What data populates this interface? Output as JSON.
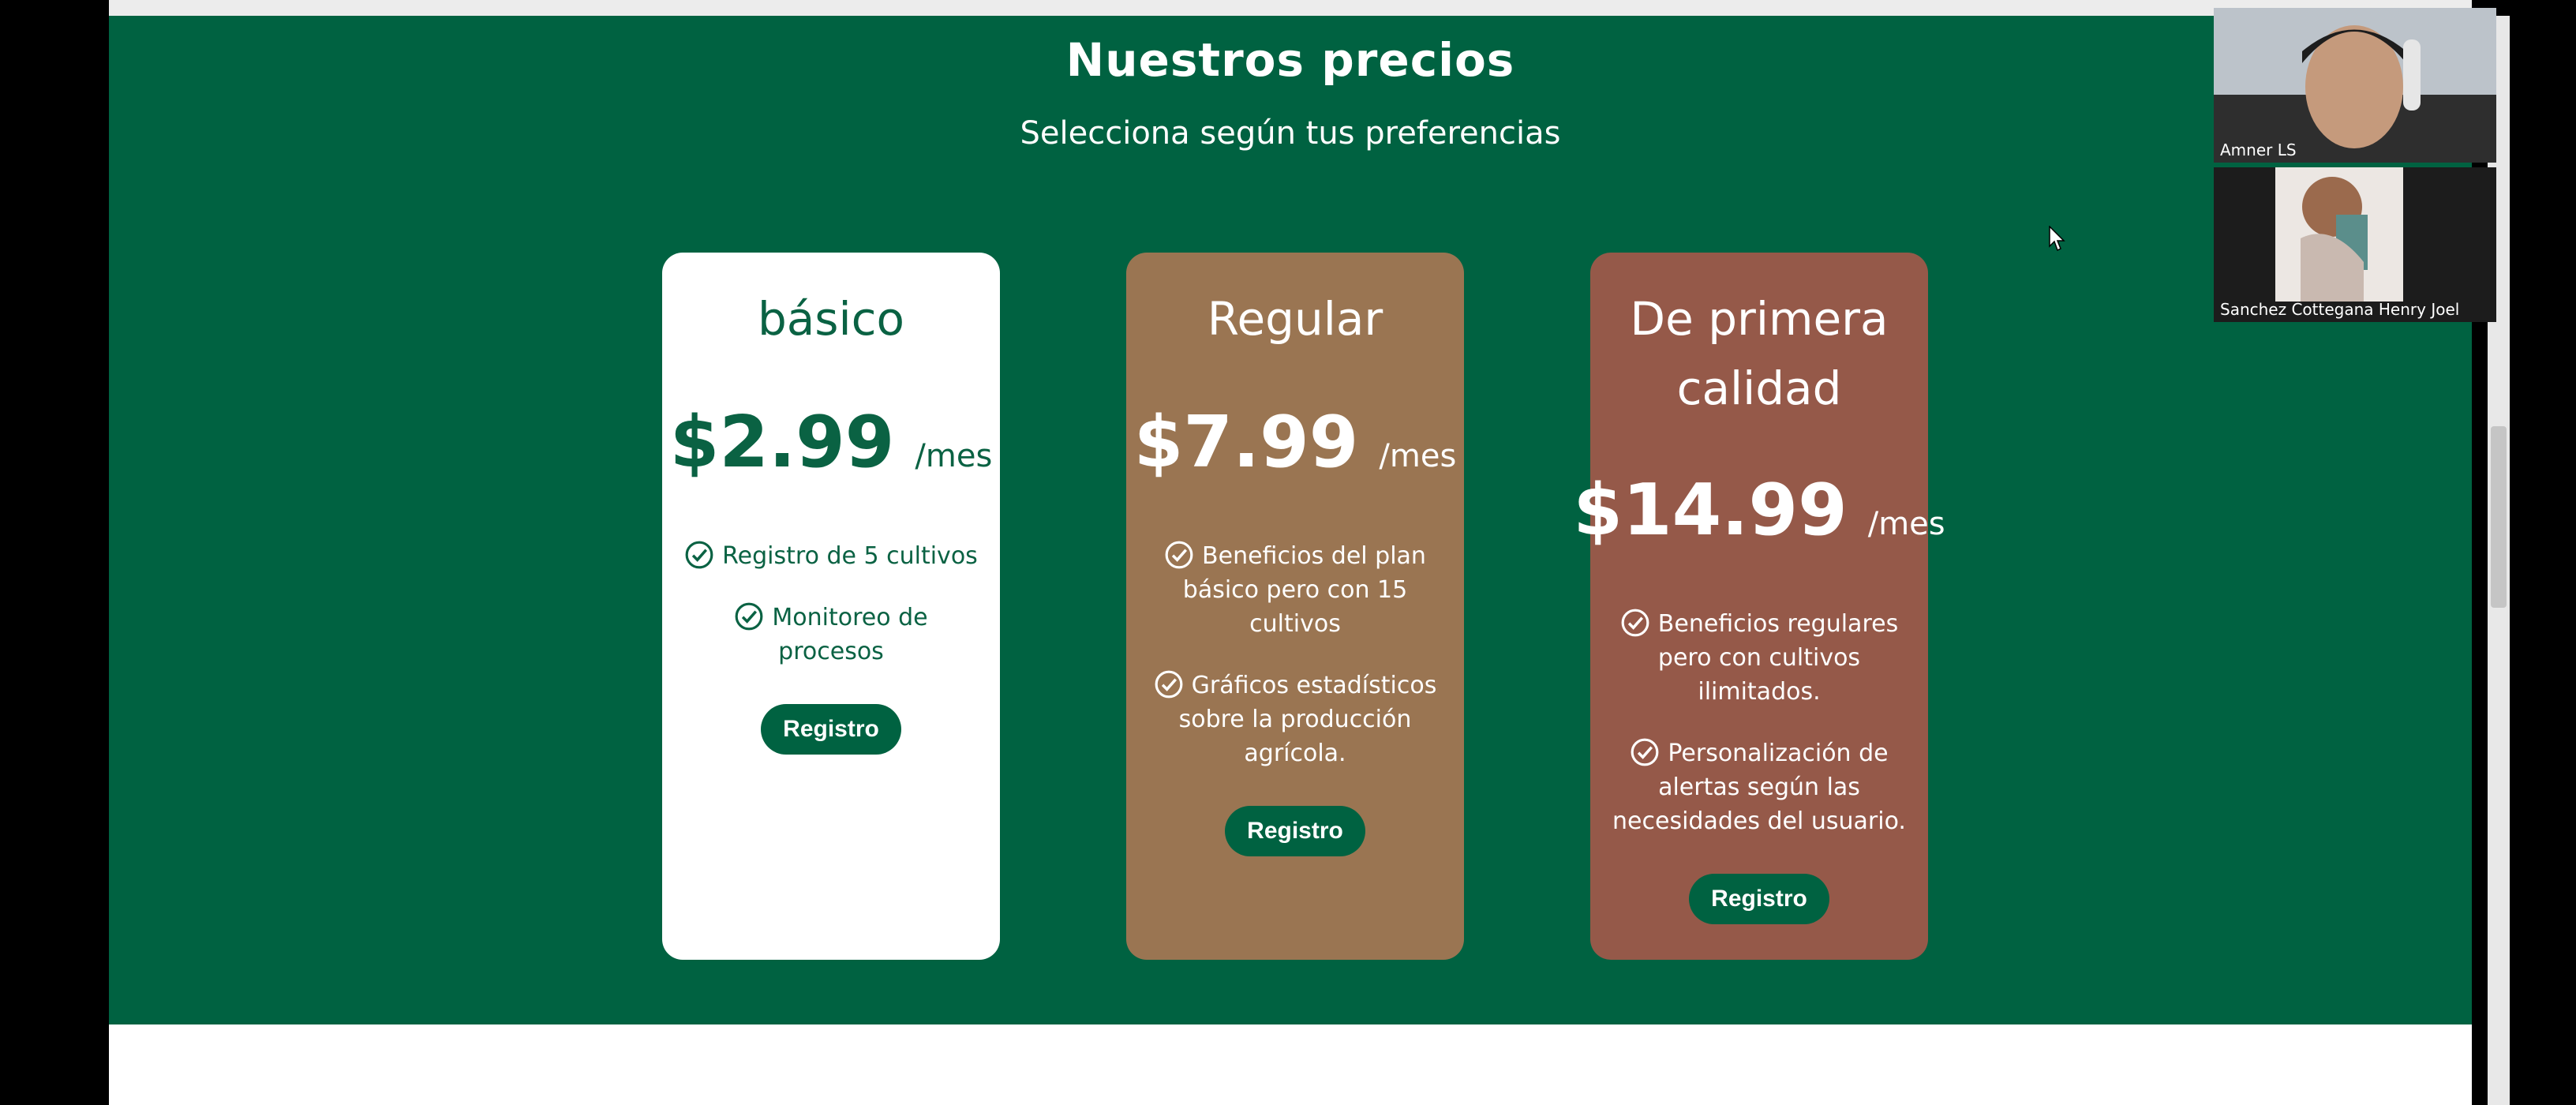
{
  "pricing": {
    "title": "Nuestros precios",
    "subtitle": "Selecciona según tus preferencias",
    "plans": [
      {
        "name": "básico",
        "price": "$2.99",
        "period": "/mes",
        "features": [
          "Registro de 5 cultivos",
          "Monitoreo de procesos"
        ],
        "button": "Registro"
      },
      {
        "name": "Regular",
        "price": "$7.99",
        "period": "/mes",
        "features": [
          "Beneficios del plan básico pero con 15 cultivos",
          "Gráficos estadísticos sobre la producción agrícola."
        ],
        "button": "Registro"
      },
      {
        "name": "De primera calidad",
        "price": "$14.99",
        "period": "/mes",
        "features": [
          "Beneficios regulares pero con cultivos ilimitados.",
          "Personalización de alertas según las necesidades del usuario."
        ],
        "button": "Registro"
      }
    ]
  },
  "video_call": {
    "participants": [
      "Amner LS",
      "Sanchez Cottegana Henry Joel"
    ]
  },
  "colors": {
    "brand_green": "#006241",
    "plan_regular": "#9a7552",
    "plan_premium": "#955949"
  },
  "icons": {
    "feature": "check-circle-icon",
    "pointer": "mouse-cursor-icon"
  }
}
